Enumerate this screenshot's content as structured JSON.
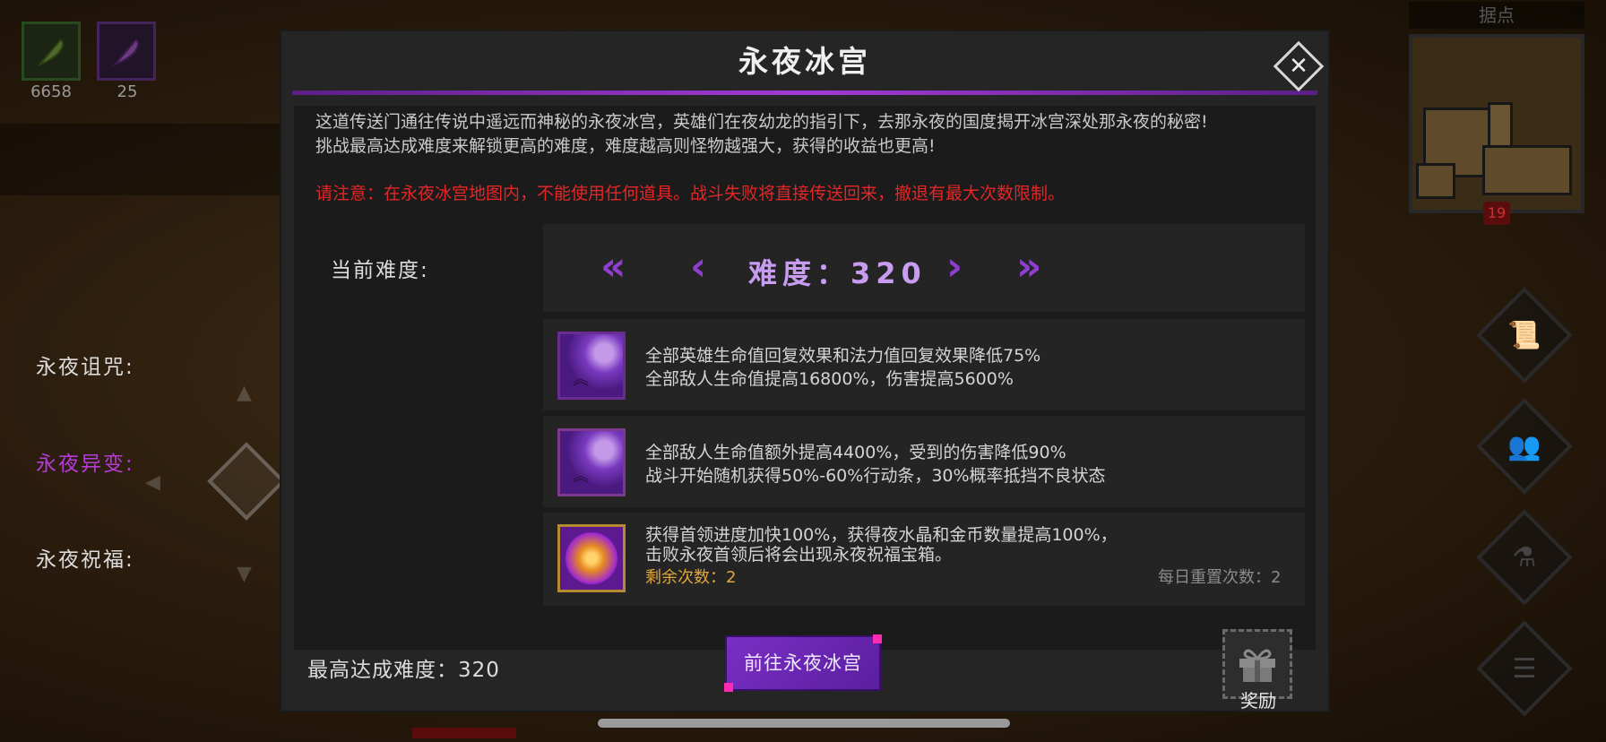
{
  "resources": {
    "green_value": "6658",
    "purple_value": "25",
    "green_icon": "green-feather-icon",
    "purple_icon": "purple-feather-icon"
  },
  "right_panel": {
    "outpost_label": "据点",
    "map_badge": "19"
  },
  "dialog": {
    "title": "永夜冰宫",
    "description_line1": "这道传送门通往传说中遥远而神秘的永夜冰宫，英雄们在夜幼龙的指引下，去那永夜的国度揭开冰宫深处那永夜的秘密!",
    "description_line2": "挑战最高达成难度来解锁更高的难度，难度越高则怪物越强大，获得的收益也更高!",
    "warning": "请注意：在永夜冰宫地图内，不能使用任何道具。战斗失败将直接传送回来，撤退有最大次数限制。",
    "current_difficulty_label": "当前难度:",
    "difficulty_display": "难度：320",
    "curse": {
      "label": "永夜诅咒:",
      "line1": "全部英雄生命值回复效果和法力值回复效果降低75%",
      "line2": "全部敌人生命值提高16800%，伤害提高5600%"
    },
    "mutation": {
      "label": "永夜异变:",
      "line1": "全部敌人生命值额外提高4400%，受到的伤害降低90%",
      "line2": "战斗开始随机获得50%-60%行动条，30%概率抵挡不良状态"
    },
    "blessing": {
      "label": "永夜祝福:",
      "line1": "获得首领进度加快100%，获得夜水晶和金币数量提高100%，",
      "line2": "击败永夜首领后将会出现永夜祝福宝箱。",
      "remaining": "剩余次数：2",
      "daily_reset": "每日重置次数：2"
    },
    "best_difficulty": "最高达成难度：320",
    "go_button": "前往永夜冰宫",
    "reward_label": "奖励"
  },
  "colors": {
    "accent_purple": "#8f3fd0",
    "warning_red": "#e42626",
    "remaining_gold": "#e2a73a"
  }
}
